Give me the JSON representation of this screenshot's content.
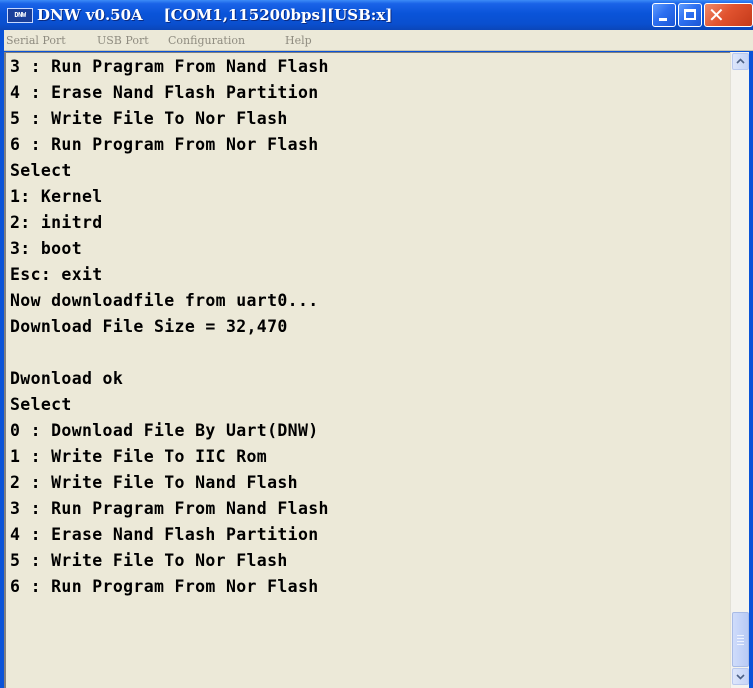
{
  "window": {
    "app_icon_text": "DNW",
    "title": "DNW v0.50A    [COM1,115200bps][USB:x]"
  },
  "menu": {
    "items": [
      "Serial Port",
      "USB Port",
      "Configuration",
      "Help"
    ]
  },
  "terminal": {
    "lines": [
      "3 : Run Pragram From Nand Flash",
      "4 : Erase Nand Flash Partition",
      "5 : Write File To Nor Flash",
      "6 : Run Program From Nor Flash",
      "Select",
      "1: Kernel",
      "2: initrd",
      "3: boot",
      "Esc: exit",
      "Now downloadfile from uart0...",
      "Download File Size = 32,470",
      "",
      "Dwonload ok",
      "Select",
      "0 : Download File By Uart(DNW)",
      "1 : Write File To IIC Rom",
      "2 : Write File To Nand Flash",
      "3 : Run Pragram From Nand Flash",
      "4 : Erase Nand Flash Partition",
      "5 : Write File To Nor Flash",
      "6 : Run Program From Nor Flash"
    ]
  },
  "colors": {
    "titlebar": "#0a54d9",
    "terminal_bg": "#ece9d8",
    "close_button": "#e1532f"
  },
  "icons": {
    "app": "dnw-app-icon",
    "minimize": "minimize-icon",
    "maximize": "maximize-icon",
    "close": "close-icon",
    "scroll_up": "scroll-up-arrow-icon",
    "scroll_down": "scroll-down-arrow-icon"
  }
}
